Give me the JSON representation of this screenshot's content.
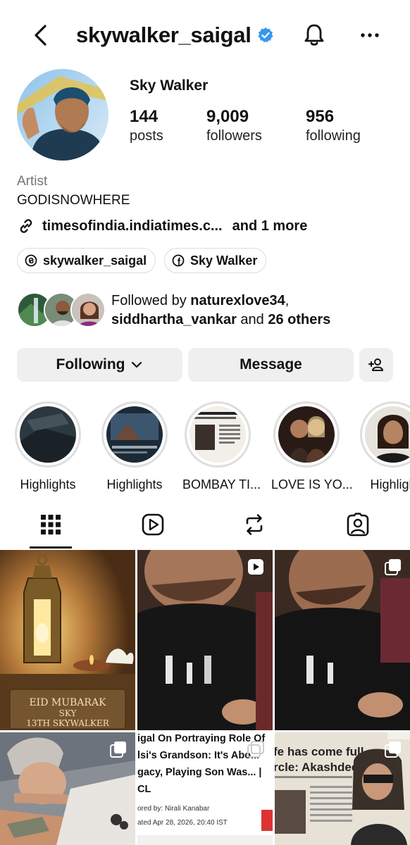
{
  "header": {
    "username": "skywalker_saigal"
  },
  "profile": {
    "display_name": "Sky Walker",
    "stats": [
      {
        "num": "144",
        "label": "posts"
      },
      {
        "num": "9,009",
        "label": "followers"
      },
      {
        "num": "956",
        "label": "following"
      }
    ],
    "category": "Artist",
    "bio": "GODISNOWHERE",
    "link": "timesofindia.indiatimes.c...",
    "link_more": "and 1 more",
    "chips": {
      "threads": "skywalker_saigal",
      "facebook": "Sky Walker"
    },
    "followed_by": {
      "prefix": "Followed by ",
      "user1": "naturexlove34",
      "sep": ",",
      "user2": "siddhartha_vankar",
      "and": " and ",
      "others": "26 others"
    }
  },
  "actions": {
    "following": "Following",
    "message": "Message"
  },
  "highlights": [
    {
      "label": "Highlights"
    },
    {
      "label": "Highlights"
    },
    {
      "label": "BOMBAY TI..."
    },
    {
      "label": "LOVE IS YO..."
    },
    {
      "label": "Highligh"
    }
  ],
  "tabs": [
    "grid-icon",
    "reels-icon",
    "reposts-icon",
    "tagged-icon"
  ],
  "posts": {
    "eid_card": {
      "line1": "EID MUBARAK",
      "line2": "SKY",
      "line3": "13TH SKYWALKER"
    },
    "article1": {
      "title_1": "igal On Portraying Role Of",
      "title_2": "lsi's Grandson: It's Abo...",
      "title_3": "gacy, Playing Son Was... |",
      "title_4": "CL",
      "byline": "ored by: Nirali Kanabar",
      "date": "ated Apr 28, 2026, 20:40 IST"
    },
    "article2": {
      "headline_1": "fe has come full",
      "headline_2": "rcle: Akashdeep"
    }
  },
  "colors": {
    "verified": "#3797f0",
    "button_bg": "#efefef",
    "muted": "#737373"
  }
}
